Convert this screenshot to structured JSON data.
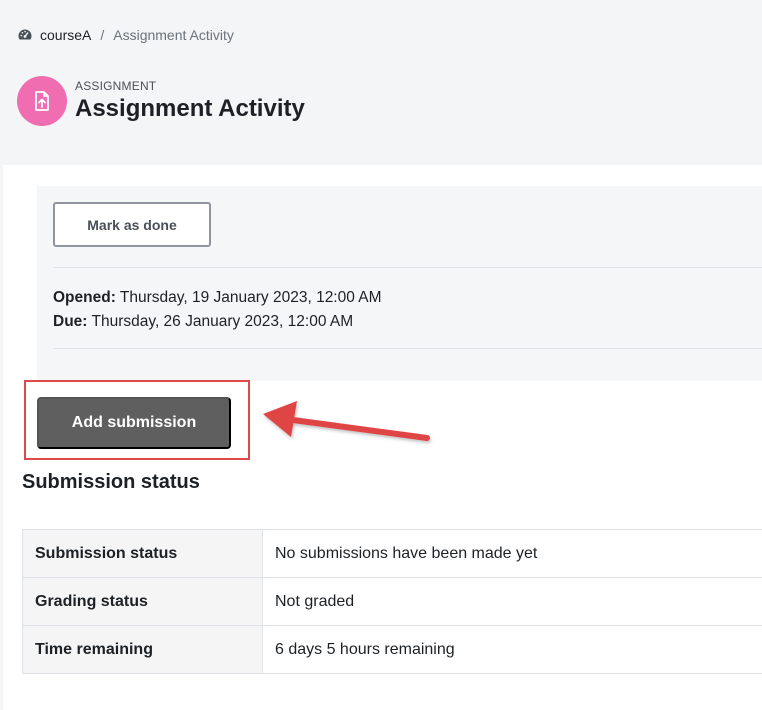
{
  "breadcrumb": {
    "icon": "dashboard-icon",
    "course": "courseA",
    "separator": "/",
    "current": "Assignment Activity"
  },
  "header": {
    "icon": "assignment-upload-icon",
    "icon_color": "#ef6db0",
    "type_label": "ASSIGNMENT",
    "title": "Assignment Activity"
  },
  "info": {
    "mark_done_label": "Mark as done",
    "opened_label": "Opened:",
    "opened_value": "Thursday, 19 January 2023, 12:00 AM",
    "due_label": "Due:",
    "due_value": "Thursday, 26 January 2023, 12:00 AM"
  },
  "actions": {
    "add_submission_label": "Add submission",
    "highlight_color": "#de4a4a"
  },
  "submission": {
    "section_title": "Submission status",
    "rows": [
      {
        "label": "Submission status",
        "value": "No submissions have been made yet"
      },
      {
        "label": "Grading status",
        "value": "Not graded"
      },
      {
        "label": "Time remaining",
        "value": "6 days 5 hours remaining"
      }
    ]
  }
}
